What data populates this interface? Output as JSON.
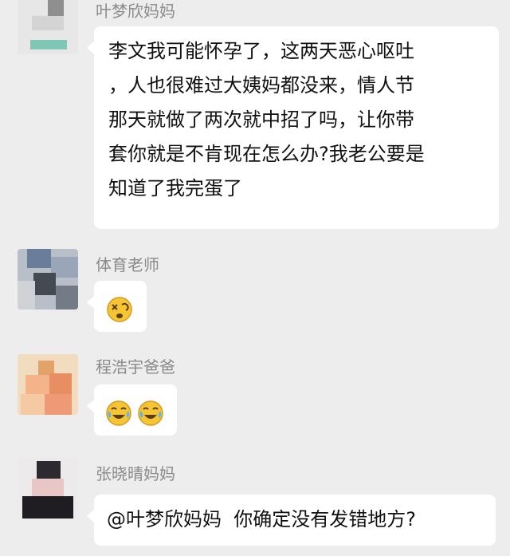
{
  "messages": [
    {
      "sender": "叶梦欣妈妈",
      "text": "李文我可能怀孕了，这两天恶心呕吐，人也很难过大姨妈都没来，情人节那天就做了两次就中招了吗，让你带套你就是不肯现在怎么办?我老公要是知道了我完蛋了",
      "lines": [
        "李文我可能怀孕了，这两天恶心呕吐",
        "，人也很难过大姨妈都没来，情人节",
        "那天就做了两次就中招了吗，让你带",
        "套你就是不肯现在怎么办?我老公要是",
        "知道了我完蛋了"
      ]
    },
    {
      "sender": "体育老师",
      "emojis": [
        "dizzy-face"
      ]
    },
    {
      "sender": "程浩宇爸爸",
      "emojis": [
        "laughing-crying-face",
        "laughing-crying-face"
      ]
    },
    {
      "sender": "张晓晴妈妈",
      "text": "@叶梦欣妈妈  你确定没有发错地方?"
    }
  ],
  "colors": {
    "background": "#ededed",
    "bubble": "#ffffff",
    "sender_name": "#8a8a8a",
    "emoji_yellow": "#f6c533"
  }
}
